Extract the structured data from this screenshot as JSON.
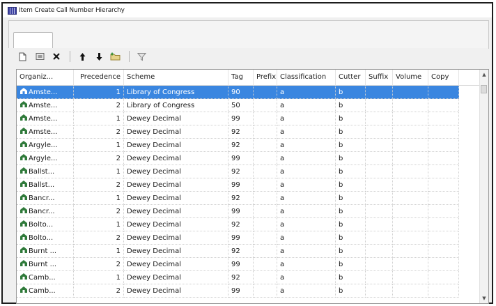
{
  "window": {
    "title": "Item Create Call Number Hierarchy"
  },
  "toolbar": {
    "buttons": [
      "new-icon",
      "open-icon",
      "delete-icon",
      "move-up-icon",
      "move-down-icon",
      "add-folder-icon",
      "filter-icon"
    ]
  },
  "grid": {
    "columns": [
      "Organiz...",
      "Precedence",
      "Scheme",
      "Tag",
      "Prefix",
      "Classification",
      "Cutter",
      "Suffix",
      "Volume",
      "Copy"
    ],
    "rows": [
      {
        "org": "Amste...",
        "prec": "1",
        "scheme": "Library of Congress",
        "tag": "90",
        "prefix": "",
        "class": "a",
        "cutter": "b",
        "suffix": "",
        "volume": "",
        "copy": "",
        "selected": true
      },
      {
        "org": "Amste...",
        "prec": "2",
        "scheme": "Library of Congress",
        "tag": "50",
        "prefix": "",
        "class": "a",
        "cutter": "b",
        "suffix": "",
        "volume": "",
        "copy": ""
      },
      {
        "org": "Amste...",
        "prec": "1",
        "scheme": "Dewey Decimal",
        "tag": "99",
        "prefix": "",
        "class": "a",
        "cutter": "b",
        "suffix": "",
        "volume": "",
        "copy": ""
      },
      {
        "org": "Amste...",
        "prec": "2",
        "scheme": "Dewey Decimal",
        "tag": "92",
        "prefix": "",
        "class": "a",
        "cutter": "b",
        "suffix": "",
        "volume": "",
        "copy": ""
      },
      {
        "org": "Argyle...",
        "prec": "1",
        "scheme": "Dewey Decimal",
        "tag": "92",
        "prefix": "",
        "class": "a",
        "cutter": "b",
        "suffix": "",
        "volume": "",
        "copy": ""
      },
      {
        "org": "Argyle...",
        "prec": "2",
        "scheme": "Dewey Decimal",
        "tag": "99",
        "prefix": "",
        "class": "a",
        "cutter": "b",
        "suffix": "",
        "volume": "",
        "copy": ""
      },
      {
        "org": "Ballst...",
        "prec": "1",
        "scheme": "Dewey Decimal",
        "tag": "92",
        "prefix": "",
        "class": "a",
        "cutter": "b",
        "suffix": "",
        "volume": "",
        "copy": ""
      },
      {
        "org": "Ballst...",
        "prec": "2",
        "scheme": "Dewey Decimal",
        "tag": "99",
        "prefix": "",
        "class": "a",
        "cutter": "b",
        "suffix": "",
        "volume": "",
        "copy": ""
      },
      {
        "org": "Bancr...",
        "prec": "1",
        "scheme": "Dewey Decimal",
        "tag": "92",
        "prefix": "",
        "class": "a",
        "cutter": "b",
        "suffix": "",
        "volume": "",
        "copy": ""
      },
      {
        "org": "Bancr...",
        "prec": "2",
        "scheme": "Dewey Decimal",
        "tag": "99",
        "prefix": "",
        "class": "a",
        "cutter": "b",
        "suffix": "",
        "volume": "",
        "copy": ""
      },
      {
        "org": "Bolto...",
        "prec": "1",
        "scheme": "Dewey Decimal",
        "tag": "92",
        "prefix": "",
        "class": "a",
        "cutter": "b",
        "suffix": "",
        "volume": "",
        "copy": ""
      },
      {
        "org": "Bolto...",
        "prec": "2",
        "scheme": "Dewey Decimal",
        "tag": "99",
        "prefix": "",
        "class": "a",
        "cutter": "b",
        "suffix": "",
        "volume": "",
        "copy": ""
      },
      {
        "org": "Burnt ...",
        "prec": "1",
        "scheme": "Dewey Decimal",
        "tag": "92",
        "prefix": "",
        "class": "a",
        "cutter": "b",
        "suffix": "",
        "volume": "",
        "copy": ""
      },
      {
        "org": "Burnt ...",
        "prec": "2",
        "scheme": "Dewey Decimal",
        "tag": "99",
        "prefix": "",
        "class": "a",
        "cutter": "b",
        "suffix": "",
        "volume": "",
        "copy": ""
      },
      {
        "org": "Camb...",
        "prec": "1",
        "scheme": "Dewey Decimal",
        "tag": "92",
        "prefix": "",
        "class": "a",
        "cutter": "b",
        "suffix": "",
        "volume": "",
        "copy": ""
      },
      {
        "org": "Camb...",
        "prec": "2",
        "scheme": "Dewey Decimal",
        "tag": "99",
        "prefix": "",
        "class": "a",
        "cutter": "b",
        "suffix": "",
        "volume": "",
        "copy": ""
      }
    ]
  },
  "colors": {
    "selection": "#3a86e0",
    "org_icon": "#2f7a3a"
  }
}
